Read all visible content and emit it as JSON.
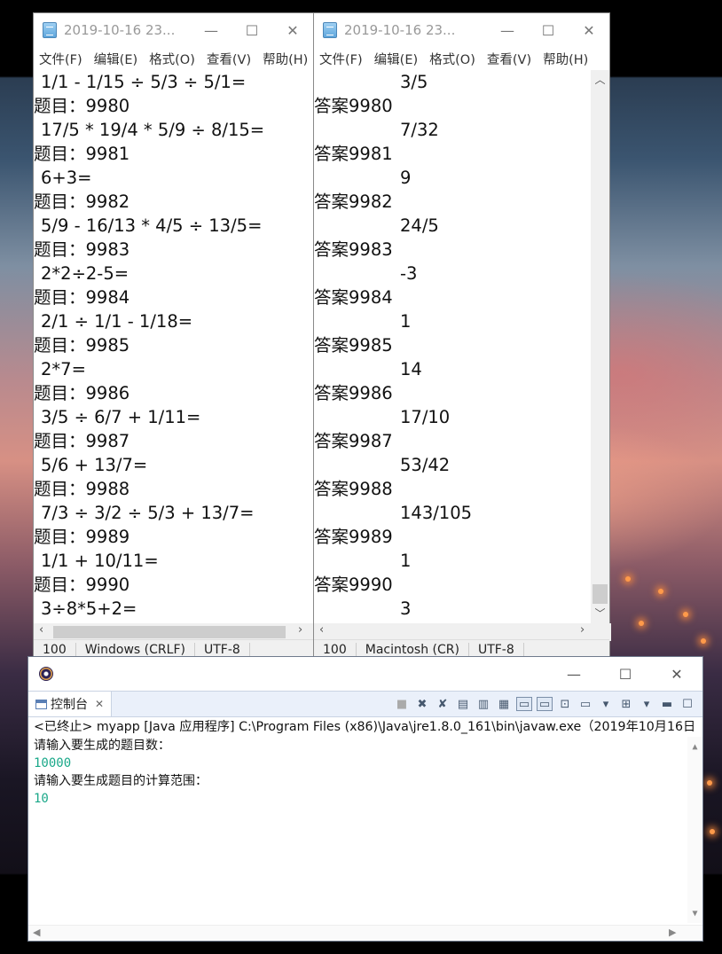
{
  "left_notepad": {
    "title": "2019-10-16 23...",
    "menu": [
      "文件(F)",
      "编辑(E)",
      "格式(O)",
      "查看(V)",
      "帮助(H)"
    ],
    "lines": [
      {
        "text": "1/1 - 1/15 ÷ 5/3 ÷ 5/1=",
        "kind": "expr"
      },
      {
        "text": "题目：9980",
        "kind": "label"
      },
      {
        "text": "17/5 * 19/4 * 5/9 ÷ 8/15=",
        "kind": "expr"
      },
      {
        "text": "题目：9981",
        "kind": "label"
      },
      {
        "text": "6+3=",
        "kind": "expr"
      },
      {
        "text": "题目：9982",
        "kind": "label"
      },
      {
        "text": "5/9 - 16/13 * 4/5 ÷ 13/5=",
        "kind": "expr"
      },
      {
        "text": "题目：9983",
        "kind": "label"
      },
      {
        "text": "2*2÷2-5=",
        "kind": "expr"
      },
      {
        "text": "题目：9984",
        "kind": "label"
      },
      {
        "text": "2/1 ÷ 1/1 - 1/18=",
        "kind": "expr"
      },
      {
        "text": "题目：9985",
        "kind": "label"
      },
      {
        "text": "2*7=",
        "kind": "expr"
      },
      {
        "text": "题目：9986",
        "kind": "label"
      },
      {
        "text": "3/5 ÷ 6/7 + 1/11=",
        "kind": "expr"
      },
      {
        "text": "题目：9987",
        "kind": "label"
      },
      {
        "text": "5/6 + 13/7=",
        "kind": "expr"
      },
      {
        "text": "题目：9988",
        "kind": "label"
      },
      {
        "text": "7/3 ÷ 3/2 ÷ 5/3 + 13/7=",
        "kind": "expr"
      },
      {
        "text": "题目：9989",
        "kind": "label"
      },
      {
        "text": "1/1 + 10/11=",
        "kind": "expr"
      },
      {
        "text": "题目：9990",
        "kind": "label"
      },
      {
        "text": "3÷8*5+2=",
        "kind": "expr"
      }
    ],
    "status": {
      "position": "100",
      "line_ending": "Windows (CRLF)",
      "encoding": "UTF-8"
    }
  },
  "right_notepad": {
    "title": "2019-10-16 23...",
    "menu": [
      "文件(F)",
      "编辑(E)",
      "格式(O)",
      "查看(V)",
      "帮助(H)"
    ],
    "lines": [
      {
        "text": "3/5",
        "kind": "ans"
      },
      {
        "text": "答案9980",
        "kind": "label"
      },
      {
        "text": "7/32",
        "kind": "ans"
      },
      {
        "text": "答案9981",
        "kind": "label"
      },
      {
        "text": "9",
        "kind": "ans"
      },
      {
        "text": "答案9982",
        "kind": "label"
      },
      {
        "text": "24/5",
        "kind": "ans"
      },
      {
        "text": "答案9983",
        "kind": "label"
      },
      {
        "text": "-3",
        "kind": "ans"
      },
      {
        "text": "答案9984",
        "kind": "label"
      },
      {
        "text": "1",
        "kind": "ans"
      },
      {
        "text": "答案9985",
        "kind": "label"
      },
      {
        "text": "14",
        "kind": "ans"
      },
      {
        "text": "答案9986",
        "kind": "label"
      },
      {
        "text": "17/10",
        "kind": "ans"
      },
      {
        "text": "答案9987",
        "kind": "label"
      },
      {
        "text": "53/42",
        "kind": "ans"
      },
      {
        "text": "答案9988",
        "kind": "label"
      },
      {
        "text": "143/105",
        "kind": "ans"
      },
      {
        "text": "答案9989",
        "kind": "label"
      },
      {
        "text": "1",
        "kind": "ans"
      },
      {
        "text": "答案9990",
        "kind": "label"
      },
      {
        "text": "3",
        "kind": "ans"
      }
    ],
    "status": {
      "position": "100",
      "line_ending": "Macintosh (CR)",
      "encoding": "UTF-8"
    }
  },
  "eclipse": {
    "tab_label": "控制台",
    "terminated_line": "<已终止> myapp [Java 应用程序] C:\\Program Files (x86)\\Java\\jre1.8.0_161\\bin\\javaw.exe（2019年10月16日",
    "console": [
      {
        "text": "请输入要生成的题目数：",
        "kind": "prompt"
      },
      {
        "text": "10000",
        "kind": "input"
      },
      {
        "text": "请输入要生成题目的计算范围：",
        "kind": "prompt"
      },
      {
        "text": "10",
        "kind": "input"
      }
    ]
  },
  "icons": {
    "notepad": "notepad-doc-icon",
    "eclipse": "eclipse-icon",
    "console_tab": "console-icon"
  }
}
